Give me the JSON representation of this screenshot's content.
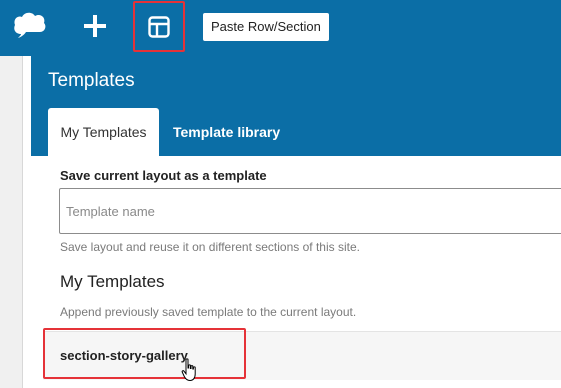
{
  "toolbar": {
    "logo_icon": "cloud-logo-icon",
    "add_icon": "plus-icon",
    "template_icon": "layout-template-icon",
    "tooltip": "Paste Row/Section",
    "bg_color": "#0b6ea6",
    "highlight_color": "#e53238"
  },
  "panel": {
    "title": "Templates",
    "tabs": [
      {
        "label": "My Templates",
        "active": true
      },
      {
        "label": "Template library",
        "active": false
      }
    ],
    "save_section": {
      "label": "Save current layout as a template",
      "input_placeholder": "Template name",
      "input_value": "",
      "help": "Save layout and reuse it on different sections of this site."
    },
    "my_templates": {
      "heading": "My Templates",
      "help": "Append previously saved template to the current layout.",
      "items": [
        {
          "label": "section-story-gallery"
        }
      ]
    }
  },
  "cursor_icon": "hand-pointer-icon"
}
